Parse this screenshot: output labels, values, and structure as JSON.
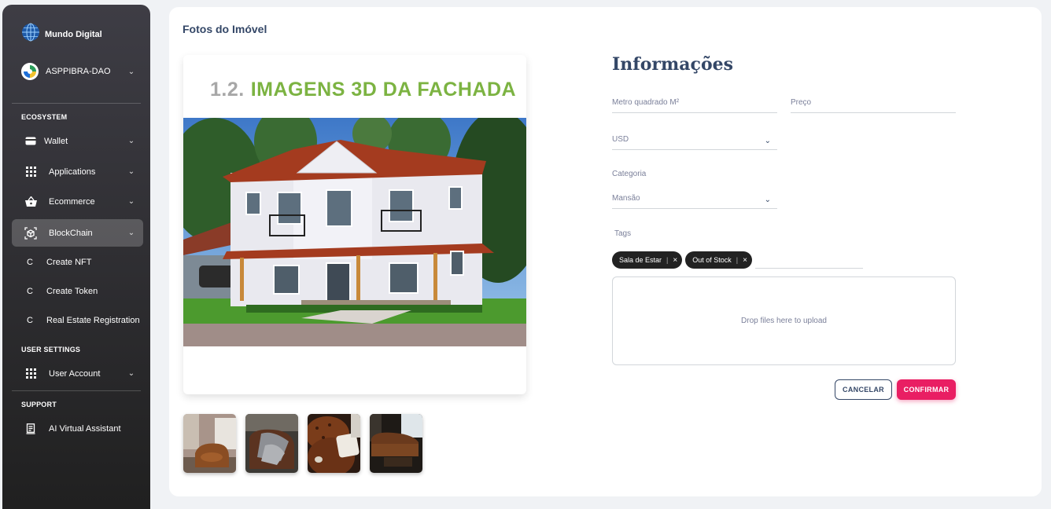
{
  "sidebar": {
    "brand": "Mundo Digital",
    "user": "ASPPIBRA-DAO",
    "sections": {
      "ecosystem": "ECOSYSTEM",
      "user_settings": "USER SETTINGS",
      "support": "SUPPORT"
    },
    "items": {
      "wallet": "Wallet",
      "applications": "Applications",
      "ecommerce": "Ecommerce",
      "blockchain": "BlockChain",
      "user_account": "User Account",
      "ai_assistant": "AI Virtual Assistant"
    },
    "sub_items": [
      {
        "letter": "C",
        "label": "Create NFT"
      },
      {
        "letter": "C",
        "label": "Create Token"
      },
      {
        "letter": "C",
        "label": "Real Estate Registration"
      }
    ]
  },
  "main": {
    "title": "Fotos do Imóvel",
    "photo_heading_num": "1.2.",
    "photo_heading_text": "IMAGENS 3D DA FACHADA",
    "info_title": "Informações",
    "fields": {
      "area_placeholder": "Metro quadrado M²",
      "price_placeholder": "Preço",
      "currency": "USD",
      "category_label": "Categoria",
      "category_value": "Mansão",
      "tags_label": "Tags"
    },
    "tags": [
      "Sala de Estar",
      "Out of Stock"
    ],
    "dropzone": "Drop files here to upload",
    "buttons": {
      "cancel": "CANCELAR",
      "confirm": "CONFIRMAR"
    }
  },
  "colors": {
    "accent": "#e91e63",
    "heading_green": "#7cb342",
    "sidebar_top": "#3e3d45",
    "sidebar_bottom": "#202020"
  }
}
